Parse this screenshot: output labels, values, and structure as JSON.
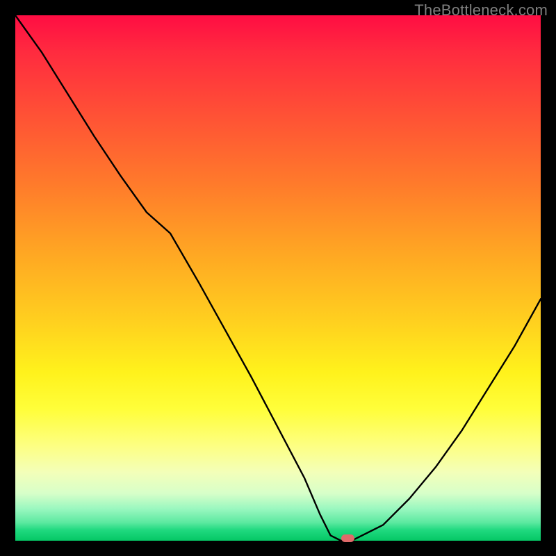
{
  "watermark": "TheBottleneck.com",
  "colors": {
    "frame": "#000000",
    "curve_stroke": "#000000",
    "marker_fill": "#e06a6a",
    "watermark_text": "#7f7f7f",
    "gradient_top": "#ff0d43",
    "gradient_bottom": "#05c765"
  },
  "chart_data": {
    "type": "line",
    "title": "",
    "xlabel": "",
    "ylabel": "",
    "xlim": [
      0,
      100
    ],
    "ylim": [
      0,
      100
    ],
    "grid": false,
    "series": [
      {
        "name": "bottleneck_curve",
        "x": [
          0,
          5,
          10,
          15,
          20,
          25,
          29.5,
          35,
          40,
          45,
          50,
          55,
          58,
          60,
          62,
          64,
          70,
          75,
          80,
          85,
          90,
          95,
          100
        ],
        "values": [
          100,
          93,
          85,
          77,
          69.5,
          62.5,
          58.5,
          49,
          40,
          31,
          21.5,
          12,
          5,
          1,
          0,
          0,
          3,
          8,
          14,
          21,
          29,
          37,
          46
        ]
      }
    ],
    "marker": {
      "x_start": 62,
      "x_end": 64.5,
      "y": 0,
      "label": "optimal_point"
    },
    "background_gradient": {
      "stops": [
        {
          "pos": 0.0,
          "color": "#ff0d43"
        },
        {
          "pos": 0.18,
          "color": "#ff4e36"
        },
        {
          "pos": 0.45,
          "color": "#ffa623"
        },
        {
          "pos": 0.68,
          "color": "#fff21c"
        },
        {
          "pos": 0.87,
          "color": "#f3ffb9"
        },
        {
          "pos": 0.96,
          "color": "#5de9a1"
        },
        {
          "pos": 1.0,
          "color": "#05c765"
        }
      ]
    }
  }
}
